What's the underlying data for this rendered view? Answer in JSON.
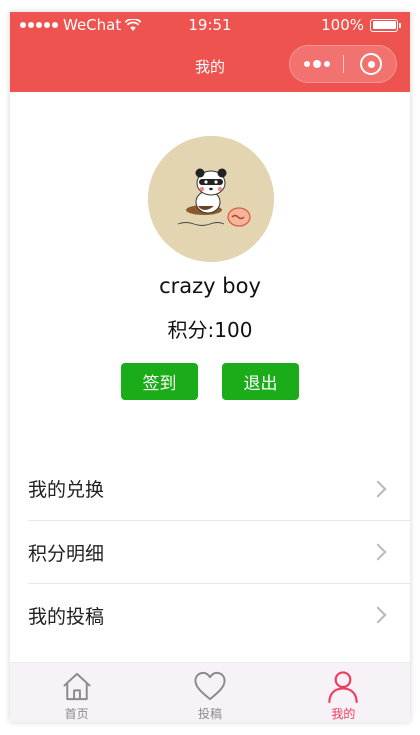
{
  "status_bar": {
    "carrier": "WeChat",
    "time": "19:51",
    "battery": "100%"
  },
  "nav": {
    "title": "我的"
  },
  "profile": {
    "username": "crazy boy",
    "points_text": "积分:100",
    "sign_in_label": "签到",
    "logout_label": "退出"
  },
  "menu": {
    "items": [
      {
        "label": "我的兑换"
      },
      {
        "label": "积分明细"
      },
      {
        "label": "我的投稿"
      }
    ]
  },
  "tabbar": {
    "tabs": [
      {
        "label": "首页",
        "icon": "home-icon",
        "active": false
      },
      {
        "label": "投稿",
        "icon": "heart-icon",
        "active": false
      },
      {
        "label": "我的",
        "icon": "person-icon",
        "active": true
      }
    ]
  },
  "colors": {
    "header": "#ef5350",
    "button": "#1aad19",
    "tab_active": "#ef3b5c",
    "tab_inactive": "#8a8a8a"
  }
}
